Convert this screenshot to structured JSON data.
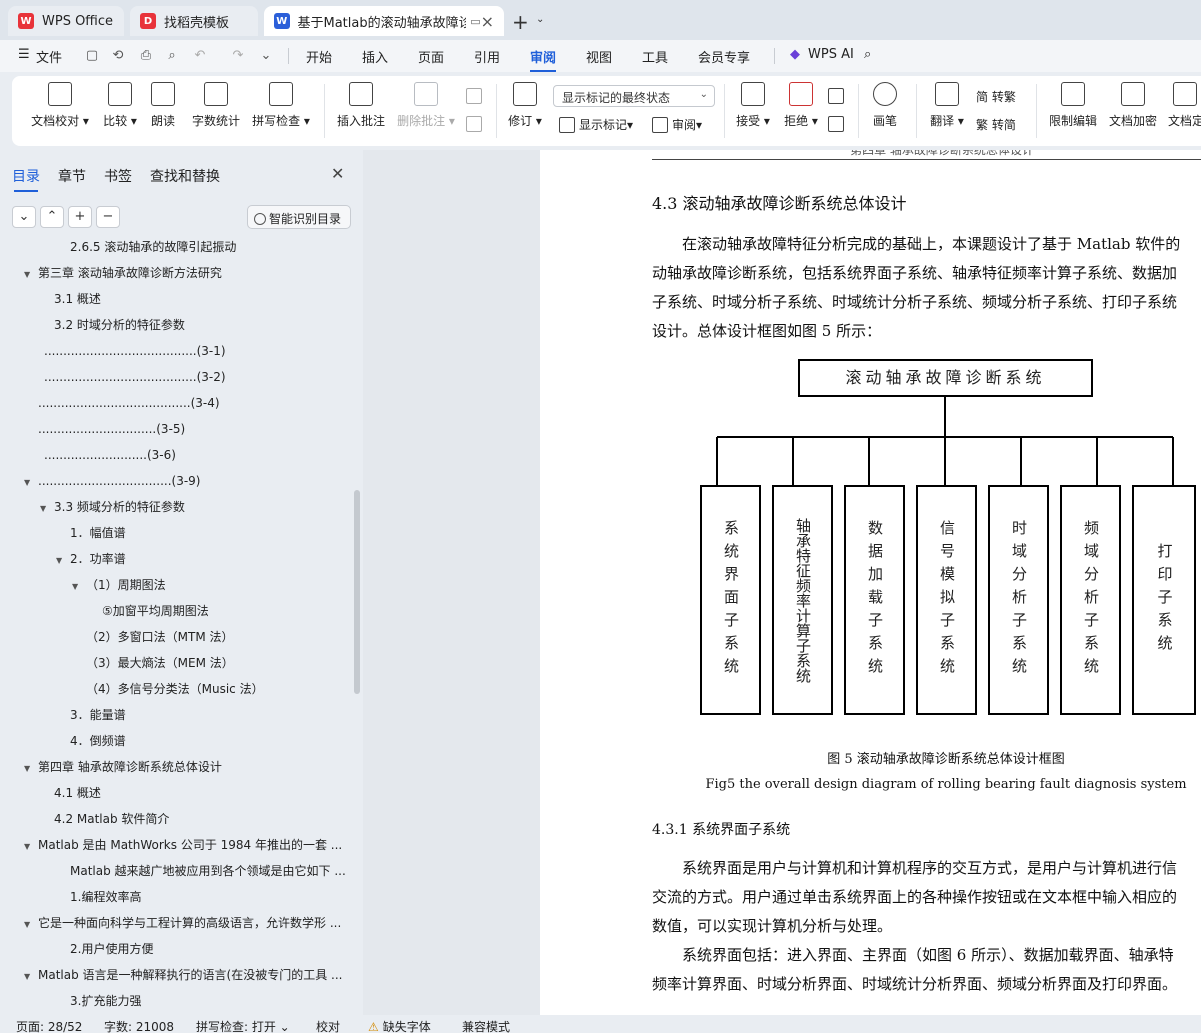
{
  "tabs": [
    {
      "label": "WPS Office",
      "icon": "wps-logo-icon"
    },
    {
      "label": "找稻壳模板",
      "icon": "docer-icon"
    },
    {
      "label": "基于Matlab的滚动轴承故障诊",
      "icon": "word-doc-icon"
    }
  ],
  "menu": {
    "file": "文件",
    "items": [
      "开始",
      "插入",
      "页面",
      "引用",
      "审阅",
      "视图",
      "工具",
      "会员专享"
    ],
    "active": "审阅",
    "wps_ai": "WPS AI"
  },
  "ribbon": {
    "doc_check": "文档校对",
    "compare": "比较",
    "read_aloud": "朗读",
    "word_count": "字数统计",
    "spell_check": "拼写检查",
    "insert_comment": "插入批注",
    "delete_comment": "删除批注",
    "revise": "修订",
    "markup_state": "显示标记的最终状态",
    "show_markup": "显示标记",
    "review": "审阅",
    "accept": "接受",
    "reject": "拒绝",
    "pen": "画笔",
    "translate": "翻译",
    "to_traditional": "简 转繁",
    "to_simplified": "繁 转简",
    "restrict_edit": "限制编辑",
    "doc_encrypt": "文档加密",
    "doc_finalize": "文档定"
  },
  "sidebar": {
    "tabs": [
      "目录",
      "章节",
      "书签",
      "查找和替换"
    ],
    "smart_toc": "智能识别目录",
    "toc": [
      {
        "text": "2.6.5 滚动轴承的故障引起振动",
        "indent": 70,
        "arrow": false
      },
      {
        "text": "第三章 滚动轴承故障诊断方法研究",
        "indent": 38,
        "arrow": true
      },
      {
        "text": "3.1 概述",
        "indent": 54,
        "arrow": false
      },
      {
        "text": "3.2 时域分析的特征参数",
        "indent": 54,
        "arrow": false
      },
      {
        "text": "........................................(3-1)",
        "indent": 44,
        "arrow": false
      },
      {
        "text": "........................................(3-2)",
        "indent": 44,
        "arrow": false
      },
      {
        "text": "........................................(3-4)",
        "indent": 38,
        "arrow": false
      },
      {
        "text": "...............................(3-5)",
        "indent": 38,
        "arrow": false
      },
      {
        "text": "...........................(3-6)",
        "indent": 44,
        "arrow": false
      },
      {
        "text": "...................................(3-9)",
        "indent": 38,
        "arrow": true
      },
      {
        "text": "3.3 频域分析的特征参数",
        "indent": 54,
        "arrow": true
      },
      {
        "text": "1．幅值谱",
        "indent": 70,
        "arrow": false
      },
      {
        "text": "2．功率谱",
        "indent": 70,
        "arrow": true
      },
      {
        "text": "（1）周期图法",
        "indent": 86,
        "arrow": true
      },
      {
        "text": "⑤加窗平均周期图法",
        "indent": 102,
        "arrow": false
      },
      {
        "text": "（2）多窗口法（MTM 法）",
        "indent": 86,
        "arrow": false
      },
      {
        "text": "（3）最大熵法（MEM 法）",
        "indent": 86,
        "arrow": false
      },
      {
        "text": "（4）多信号分类法（Music 法）",
        "indent": 86,
        "arrow": false
      },
      {
        "text": "3．能量谱",
        "indent": 70,
        "arrow": false
      },
      {
        "text": "4．倒频谱",
        "indent": 70,
        "arrow": false
      },
      {
        "text": "第四章 轴承故障诊断系统总体设计",
        "indent": 38,
        "arrow": true
      },
      {
        "text": "4.1 概述",
        "indent": 54,
        "arrow": false
      },
      {
        "text": "4.2 Matlab 软件简介",
        "indent": 54,
        "arrow": false
      },
      {
        "text": "Matlab 是由 MathWorks 公司于 1984 年推出的一套 ...",
        "indent": 38,
        "arrow": true
      },
      {
        "text": "Matlab 越来越广地被应用到各个领域是由它如下 ...",
        "indent": 70,
        "arrow": false
      },
      {
        "text": "1.编程效率高",
        "indent": 70,
        "arrow": false
      },
      {
        "text": "它是一种面向科学与工程计算的高级语言，允许数学形 ...",
        "indent": 38,
        "arrow": true
      },
      {
        "text": "2.用户使用方便",
        "indent": 70,
        "arrow": false
      },
      {
        "text": "Matlab 语言是一种解释执行的语言(在没被专门的工具 ...",
        "indent": 38,
        "arrow": true
      },
      {
        "text": "3.扩充能力强",
        "indent": 70,
        "arrow": false
      }
    ]
  },
  "document": {
    "running_header": "第四章 轴承故障诊断系统总体设计",
    "section_title": "4.3 滚动轴承故障诊断系统总体设计",
    "para1": [
      "在滚动轴承故障特征分析完成的基础上，本课题设计了基于 Matlab 软件的",
      "动轴承故障诊断系统，包括系统界面子系统、轴承特征频率计算子系统、数据加",
      "子系统、时域分析子系统、时域统计分析子系统、频域分析子系统、打印子系统",
      "设计。总体设计框图如图 5 所示："
    ],
    "diagram_title": "滚动轴承故障诊断系统",
    "subsystems": [
      "系统界面子系统",
      "轴承特征频率计算子系统",
      "数据加载子系统",
      "信号模拟子系统",
      "时域分析子系统",
      "频域分析子系统",
      "打印子系统"
    ],
    "fig_caption_cn": "图 5 滚动轴承故障诊断系统总体设计框图",
    "fig_caption_en": "Fig5 the overall design diagram of rolling bearing fault diagnosis system",
    "subsection_title": "4.3.1 系统界面子系统",
    "para2": [
      "系统界面是用户与计算机和计算机程序的交互方式，是用户与计算机进行信",
      "交流的方式。用户通过单击系统界面上的各种操作按钮或在文本框中输入相应的",
      "数值，可以实现计算机分析与处理。"
    ],
    "para3": [
      "系统界面包括：进入界面、主界面（如图 6 所示）、数据加载界面、轴承特",
      "频率计算界面、时域分析界面、时域统计分析界面、频域分析界面及打印界面。"
    ]
  },
  "status": {
    "page": "页面: 28/52",
    "words": "字数: 21008",
    "spell": "拼写检查: 打开",
    "proof": "校对",
    "missing_font": "缺失字体",
    "compat": "兼容模式"
  },
  "colors": {
    "accent": "#1f5fd9",
    "wps_red": "#e8333a",
    "doc_blue": "#2b5fd9"
  }
}
